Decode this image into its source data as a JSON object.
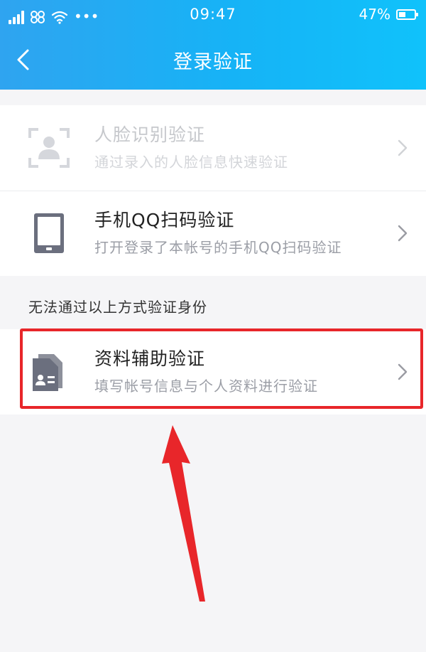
{
  "status_bar": {
    "dots": "•••",
    "time": "09:47",
    "battery": "47%",
    "battery_level": 0.47
  },
  "nav": {
    "title": "登录验证"
  },
  "methods": [
    {
      "title": "人脸识别验证",
      "subtitle": "通过录入的人脸信息快速验证",
      "icon": "face-scan-icon",
      "enabled": false
    },
    {
      "title": "手机QQ扫码验证",
      "subtitle": "打开登录了本帐号的手机QQ扫码验证",
      "icon": "phone-icon",
      "enabled": true
    }
  ],
  "section_label": "无法通过以上方式验证身份",
  "alt_method": {
    "title": "资料辅助验证",
    "subtitle": "填写帐号信息与个人资料进行验证",
    "icon": "id-document-icon"
  },
  "colors": {
    "header_start": "#2fa4f0",
    "header_end": "#10c2fb",
    "annotation": "#e8262a",
    "icon_gray": "#6b6f7e"
  }
}
